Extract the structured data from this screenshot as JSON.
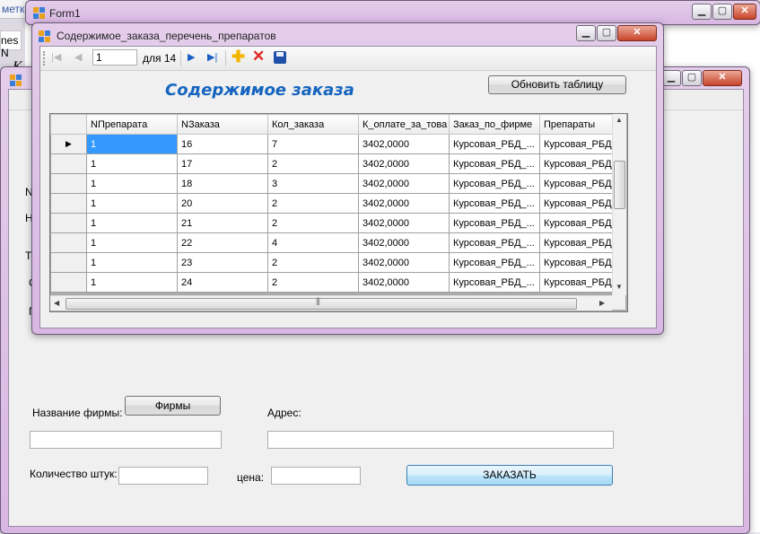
{
  "background": {
    "menu_items": [
      "метк",
      "",
      "",
      "",
      ""
    ],
    "fragment_left": "nes N",
    "fragment_k": "К"
  },
  "form1": {
    "title": "Form1"
  },
  "form2": {
    "left_letters": [
      "N",
      "Н",
      "Т",
      "С",
      "П"
    ]
  },
  "main_window": {
    "title": "Содержимое_заказа_перечень_препаратов",
    "navigator": {
      "position": "1",
      "of_label": "для 14"
    },
    "header_title": "Содержимое заказа",
    "refresh_button": "Обновить таблицу",
    "grid": {
      "columns": [
        "NПрепарата",
        "NЗаказа",
        "Кол_заказа",
        "К_оплате_за_това",
        "Заказ_по_фирме",
        "Препараты"
      ],
      "rows": [
        [
          "1",
          "16",
          "7",
          "3402,0000",
          "Курсовая_РБД_...",
          "Курсовая_РБД_"
        ],
        [
          "1",
          "17",
          "2",
          "3402,0000",
          "Курсовая_РБД_...",
          "Курсовая_РБД_"
        ],
        [
          "1",
          "18",
          "3",
          "3402,0000",
          "Курсовая_РБД_...",
          "Курсовая_РБД_"
        ],
        [
          "1",
          "20",
          "2",
          "3402,0000",
          "Курсовая_РБД_...",
          "Курсовая_РБД_"
        ],
        [
          "1",
          "21",
          "2",
          "3402,0000",
          "Курсовая_РБД_...",
          "Курсовая_РБД_"
        ],
        [
          "1",
          "22",
          "4",
          "3402,0000",
          "Курсовая_РБД_...",
          "Курсовая_РБД_"
        ],
        [
          "1",
          "23",
          "2",
          "3402,0000",
          "Курсовая_РБД_...",
          "Курсовая_РБД_"
        ],
        [
          "1",
          "24",
          "2",
          "3402,0000",
          "Курсовая_РБД_...",
          "Курсовая_РБД_"
        ]
      ]
    }
  },
  "order_form": {
    "firm_label": "Название фирмы:",
    "firms_button": "Фирмы",
    "address_label": "Адрес:",
    "firm_value": "",
    "address_value": "",
    "quantity_label": "Количество штук:",
    "quantity_value": "",
    "price_label": "цена:",
    "price_value": "",
    "order_button": "ЗАКАЗАТЬ"
  },
  "colors": {
    "header_title": "#1565c0",
    "selection": "#3399ff",
    "delete_icon": "#e02424",
    "add_icon": "#f2b600",
    "save_icon": "#1f4fa8"
  }
}
